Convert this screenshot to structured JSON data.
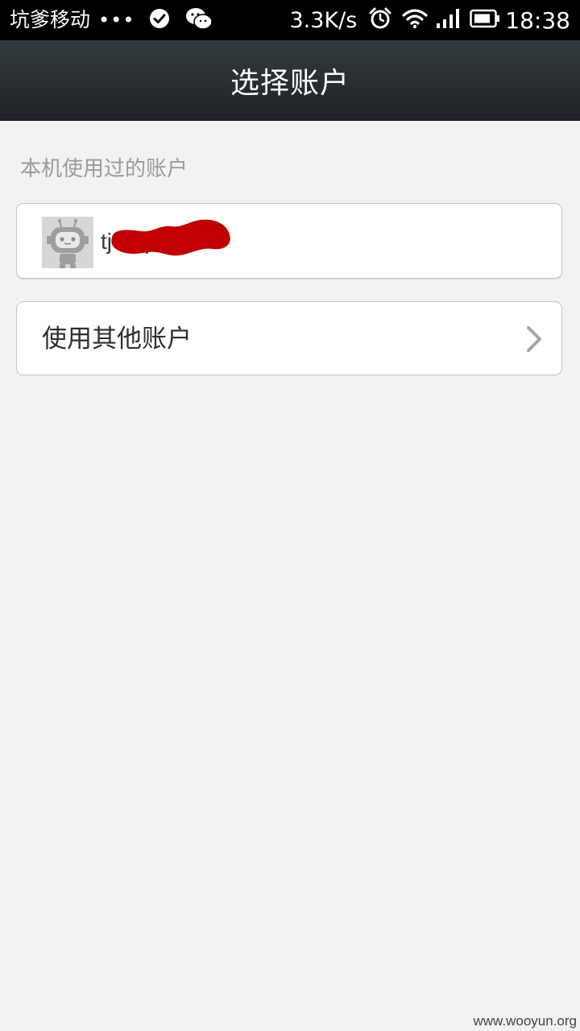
{
  "status_bar": {
    "carrier": "坑爹移动",
    "dots": "•••",
    "net_speed": "3.3K/s",
    "time": "18:38",
    "icons": [
      "check-circle-icon",
      "wechat-icon",
      "alarm-icon",
      "wifi-icon",
      "signal-icon",
      "battery-icon"
    ]
  },
  "header": {
    "title": "选择账户"
  },
  "main": {
    "section_label": "本机使用过的账户",
    "accounts": [
      {
        "email": "tj          .qq.com",
        "avatar_icon": "robot-avatar-icon",
        "redaction_color": "#c00000"
      }
    ],
    "other_account_label": "使用其他账户"
  },
  "watermark": "www.wooyun.org",
  "colors": {
    "background": "#f2f2f2",
    "title_bar": "#2a3033",
    "section_label": "#9b9b9b",
    "card_border": "#c4c4c4"
  }
}
